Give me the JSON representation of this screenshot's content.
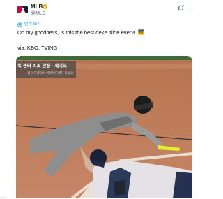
{
  "account": {
    "name": "MLB",
    "handle": "@MLB",
    "avatar_icon": "mlb-logo-icon",
    "verified_icon": "gold-check-badge-icon",
    "verified_color": "#e2b719"
  },
  "header_actions": {
    "grok_icon": "grok-icon",
    "more_label": "···"
  },
  "translate": {
    "label": "번역 보기",
    "icon": "globe-icon",
    "color": "#1d9bf0"
  },
  "tweet": {
    "line1": "Oh my goodness, is this the best deke slide ever?!",
    "line1_emoji": "scared-face-emoji",
    "line2": "via: KBO, TVING"
  },
  "media": {
    "caption_title": "독 센터 ",
    "caption_title_tail": "피초 판정 · 세이프",
    "caption_subtitle": "감 어드벤터서 아웃어드벤처 유일의"
  },
  "page_edge": "…"
}
